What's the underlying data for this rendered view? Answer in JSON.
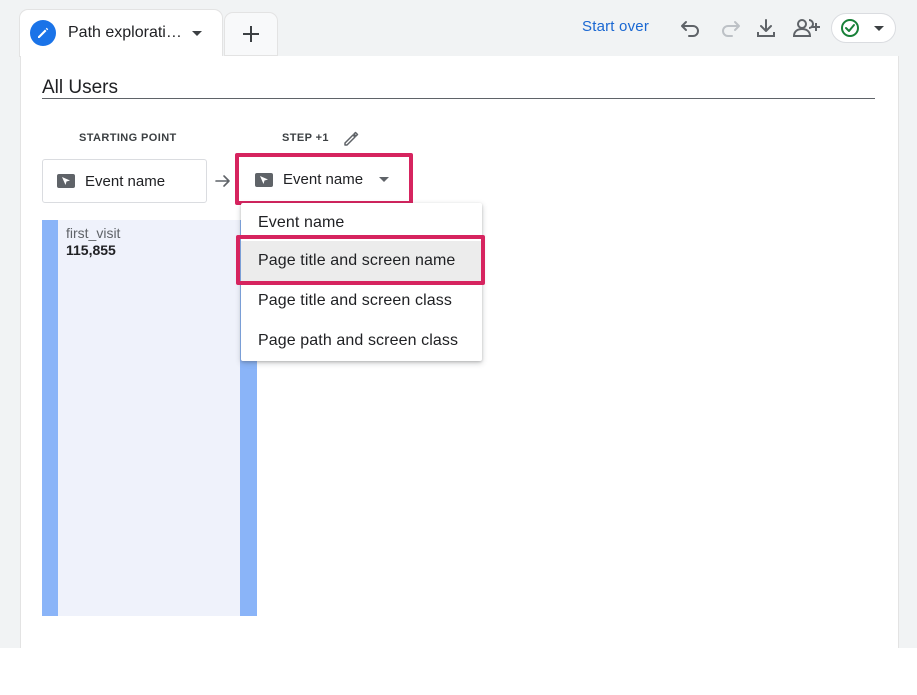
{
  "tabs": {
    "active_label": "Path explorati…",
    "add_label": "+"
  },
  "toolbar": {
    "start_over_label": "Start over",
    "icons": [
      "undo-icon",
      "redo-icon",
      "download-icon",
      "share-users-icon",
      "check-circle-icon",
      "caret-down-icon"
    ]
  },
  "segment": {
    "title": "All Users"
  },
  "columns": {
    "starting_point_label": "STARTING POINT",
    "step_label": "STEP +1"
  },
  "starting_node": {
    "label": "Event name"
  },
  "step_node": {
    "label": "Event name"
  },
  "path_bar": {
    "name": "first_visit",
    "value": "115,855"
  },
  "dropdown": {
    "options": [
      {
        "label": "Event name",
        "selected": false
      },
      {
        "label": "Page title and screen name",
        "selected": true
      },
      {
        "label": "Page title and screen class",
        "selected": false
      },
      {
        "label": "Page path and screen class",
        "selected": false
      }
    ]
  },
  "colors": {
    "accent_blue": "#1a73e8",
    "link_blue": "#1967d2",
    "highlight": "#d6245f",
    "bar_blue": "#8ab4f8",
    "check_green": "#188038"
  }
}
